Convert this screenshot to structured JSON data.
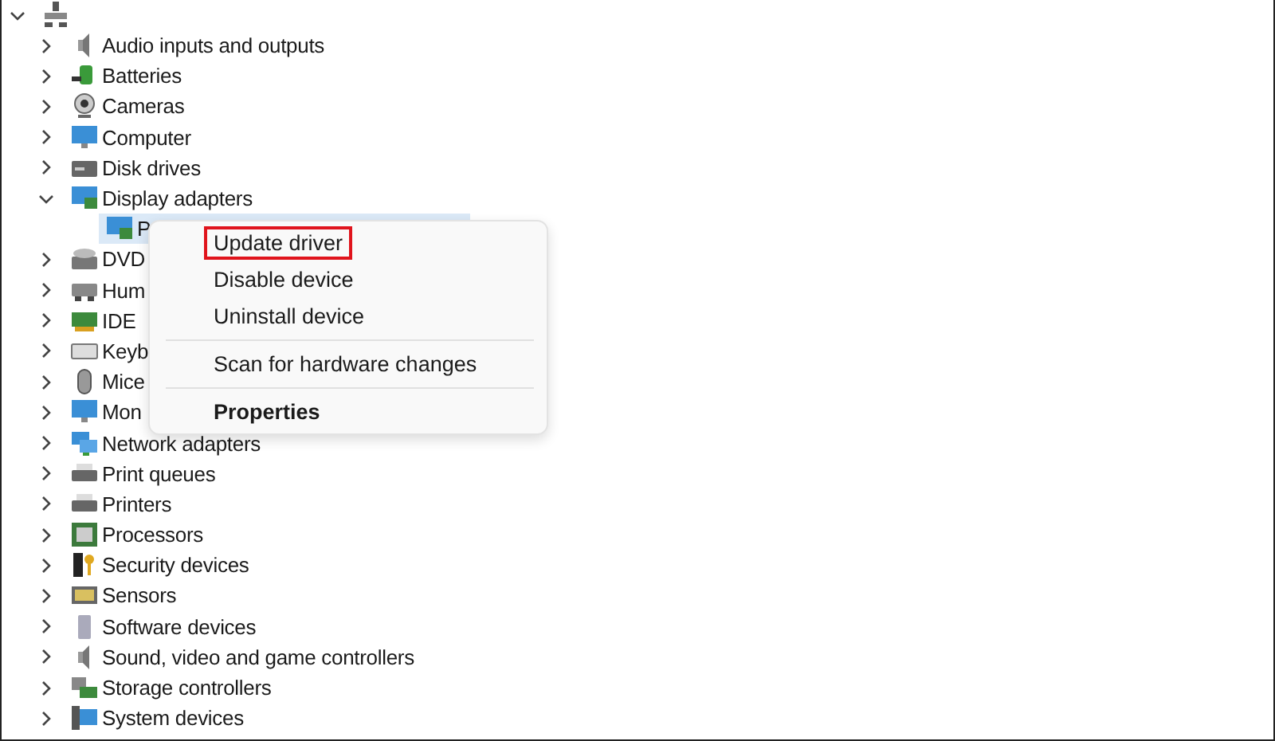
{
  "tree": {
    "expanded": true,
    "children": [
      {
        "label": "Audio inputs and outputs",
        "expanded": false
      },
      {
        "label": "Batteries",
        "expanded": false
      },
      {
        "label": "Cameras",
        "expanded": false
      },
      {
        "label": "Computer",
        "expanded": false
      },
      {
        "label": "Disk drives",
        "expanded": false
      },
      {
        "label": "Display adapters",
        "expanded": true,
        "children": [
          {
            "label": "P",
            "selected": true
          }
        ]
      },
      {
        "label": "DVD",
        "expanded": false
      },
      {
        "label": "Hum",
        "expanded": false
      },
      {
        "label": "IDE",
        "expanded": false
      },
      {
        "label": "Keyb",
        "expanded": false
      },
      {
        "label": "Mice",
        "expanded": false
      },
      {
        "label": "Mon",
        "expanded": false
      },
      {
        "label": "Network adapters",
        "expanded": false
      },
      {
        "label": "Print queues",
        "expanded": false
      },
      {
        "label": "Printers",
        "expanded": false
      },
      {
        "label": "Processors",
        "expanded": false
      },
      {
        "label": "Security devices",
        "expanded": false
      },
      {
        "label": "Sensors",
        "expanded": false
      },
      {
        "label": "Software devices",
        "expanded": false
      },
      {
        "label": "Sound, video and game controllers",
        "expanded": false
      },
      {
        "label": "Storage controllers",
        "expanded": false
      },
      {
        "label": "System devices",
        "expanded": false
      }
    ]
  },
  "context_menu": {
    "groups": [
      [
        {
          "label": "Update driver",
          "highlighted": true,
          "default": false
        },
        {
          "label": "Disable device",
          "highlighted": false,
          "default": false
        },
        {
          "label": "Uninstall device",
          "highlighted": false,
          "default": false
        }
      ],
      [
        {
          "label": "Scan for hardware changes",
          "highlighted": false,
          "default": false
        }
      ],
      [
        {
          "label": "Properties",
          "highlighted": false,
          "default": true
        }
      ]
    ]
  }
}
